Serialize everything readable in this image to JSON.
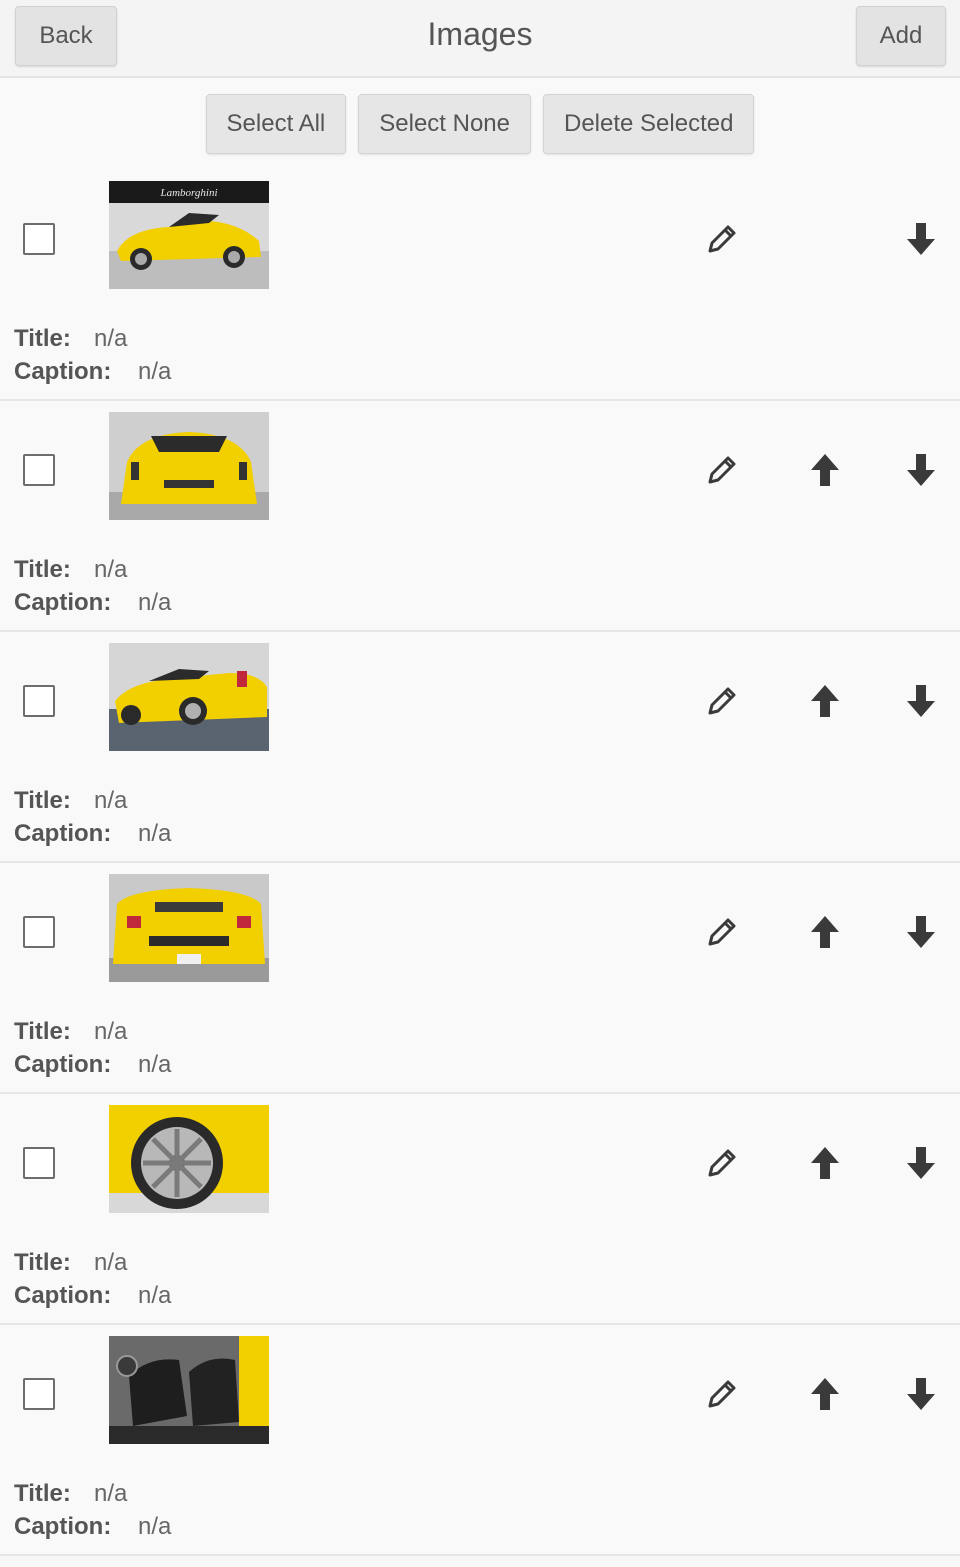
{
  "header": {
    "back_label": "Back",
    "title": "Images",
    "add_label": "Add"
  },
  "toolbar": {
    "select_all": "Select All",
    "select_none": "Select None",
    "delete_selected": "Delete Selected"
  },
  "labels": {
    "title": "Title:",
    "caption": "Caption:"
  },
  "items": [
    {
      "title": "n/a",
      "caption": "n/a",
      "thumb": "car-front-quarter-logo-banner"
    },
    {
      "title": "n/a",
      "caption": "n/a",
      "thumb": "car-front-view"
    },
    {
      "title": "n/a",
      "caption": "n/a",
      "thumb": "car-side-rear-quarter"
    },
    {
      "title": "n/a",
      "caption": "n/a",
      "thumb": "car-rear-view"
    },
    {
      "title": "n/a",
      "caption": "n/a",
      "thumb": "car-wheel-closeup"
    },
    {
      "title": "n/a",
      "caption": "n/a",
      "thumb": "car-interior-seats"
    }
  ],
  "banner_text": "Lamborghini",
  "colors": {
    "car_yellow": "#f2d000",
    "icon": "#3a3a3a",
    "header_bg": "#f4f4f4"
  },
  "icons": [
    "pencil-icon",
    "arrow-up-icon",
    "arrow-down-icon"
  ]
}
